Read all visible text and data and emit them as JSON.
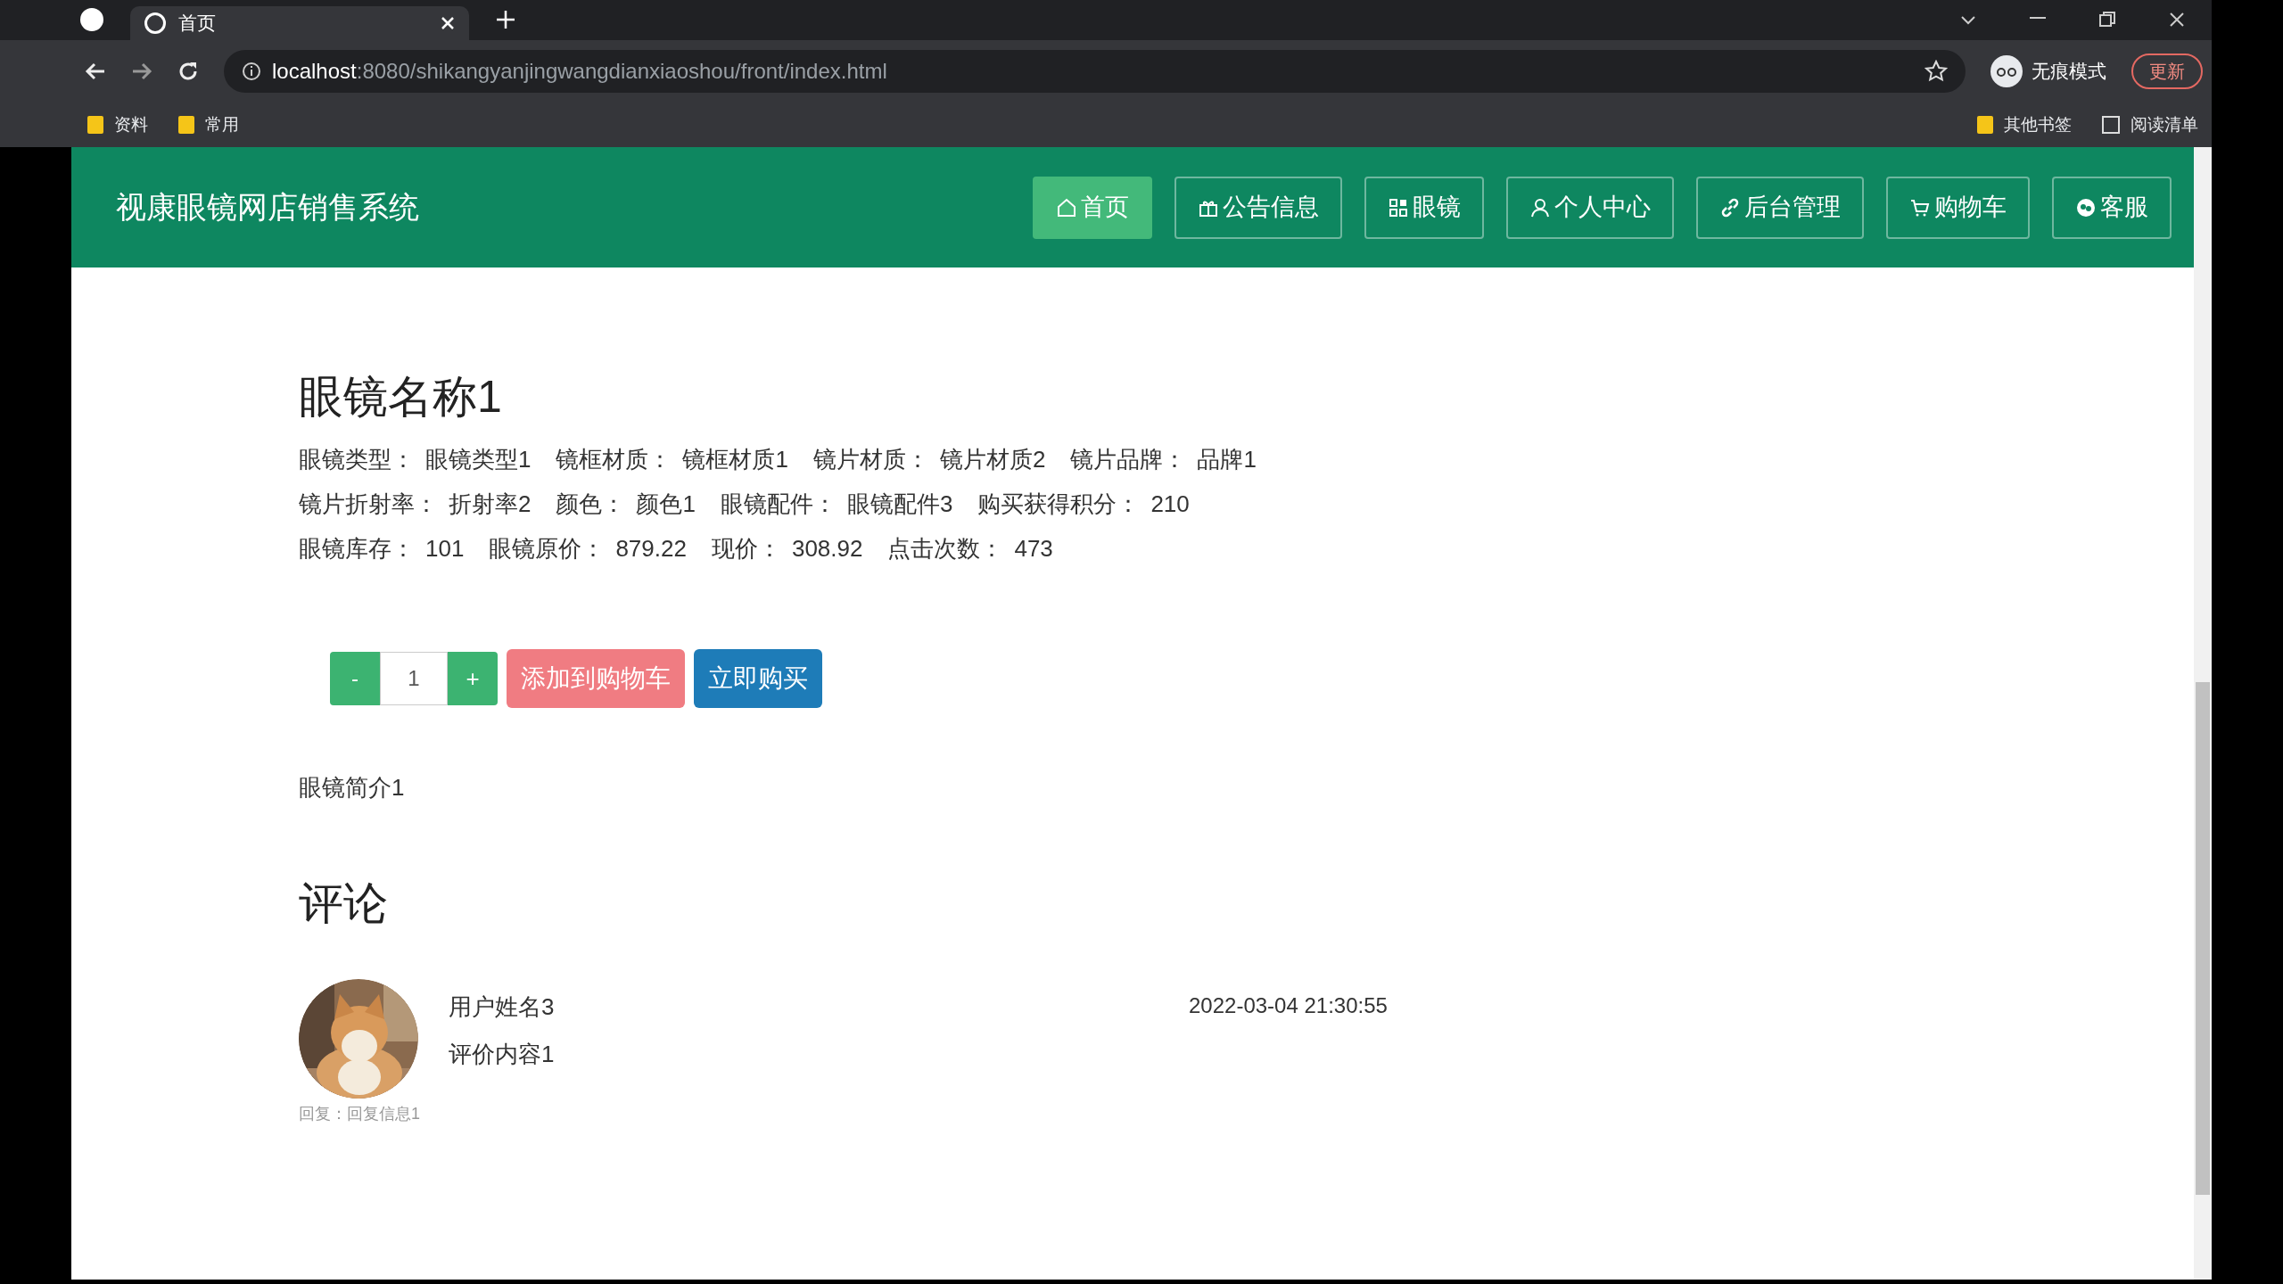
{
  "browser": {
    "tabs": [
      {
        "title": "首页",
        "selected": true
      }
    ],
    "address": {
      "host": "localhost",
      "rest": ":8080/shikangyanjingwangdianxiaoshou/front/index.html"
    },
    "profile": "无痕模式",
    "update_button": "更新",
    "bookmarks": [
      "资料",
      "常用"
    ],
    "bookmarks_right": [
      "其他书签",
      "阅读清单"
    ]
  },
  "site": {
    "title": "视康眼镜网店销售系统",
    "nav": [
      {
        "label": "首页",
        "selected": true
      },
      {
        "label": "公告信息",
        "selected": false
      },
      {
        "label": "眼镜",
        "selected": false
      },
      {
        "label": "个人中心",
        "selected": false
      },
      {
        "label": "后台管理",
        "selected": false
      },
      {
        "label": "购物车",
        "selected": false
      },
      {
        "label": "客服",
        "selected": false
      }
    ]
  },
  "product": {
    "name": "眼镜名称1",
    "attribute_rows": [
      [
        {
          "label": "眼镜类型：",
          "value": "眼镜类型1"
        },
        {
          "label": "镜框材质：",
          "value": "镜框材质1"
        },
        {
          "label": "镜片材质：",
          "value": "镜片材质2"
        },
        {
          "label": "镜片品牌：",
          "value": "品牌1"
        }
      ],
      [
        {
          "label": "镜片折射率：",
          "value": "折射率2"
        },
        {
          "label": "颜色：",
          "value": "颜色1"
        },
        {
          "label": "眼镜配件：",
          "value": "眼镜配件3"
        },
        {
          "label": "购买获得积分：",
          "value": "210"
        }
      ],
      [
        {
          "label": "眼镜库存：",
          "value": "101"
        },
        {
          "label": "眼镜原价：",
          "value": "879.22"
        },
        {
          "label": "现价：",
          "value": "308.92"
        },
        {
          "label": "点击次数：",
          "value": "473"
        }
      ]
    ],
    "minus": "-",
    "quantity": "1",
    "plus": "+",
    "add_to_cart": "添加到购物车",
    "buy_now": "立即购买",
    "description": "眼镜简介1"
  },
  "comments": {
    "heading": "评论",
    "items": [
      {
        "user": "用户姓名3",
        "content": "评价内容1",
        "time": "2022-03-04 21:30:55",
        "reply": "回复：回复信息1"
      }
    ]
  }
}
